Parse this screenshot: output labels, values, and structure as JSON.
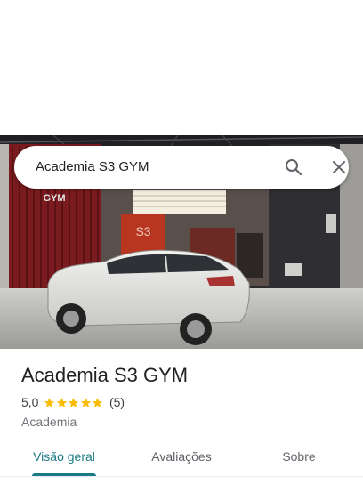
{
  "search": {
    "query": "Academia S3 GYM"
  },
  "icons": {
    "search": "search-icon",
    "close": "close-icon",
    "star": "star-icon"
  },
  "photo": {
    "sign_text": "GYM",
    "wall_logo": "S3"
  },
  "place": {
    "name": "Academia S3 GYM",
    "rating": "5,0",
    "stars": 5,
    "review_count": "(5)",
    "category": "Academia"
  },
  "tabs": [
    {
      "label": "Visão geral",
      "active": true
    },
    {
      "label": "Avaliações",
      "active": false
    },
    {
      "label": "Sobre",
      "active": false
    }
  ],
  "colors": {
    "accent": "#1a7a83",
    "star": "#fbbc04",
    "text_primary": "#202124",
    "text_secondary": "#70757a"
  }
}
